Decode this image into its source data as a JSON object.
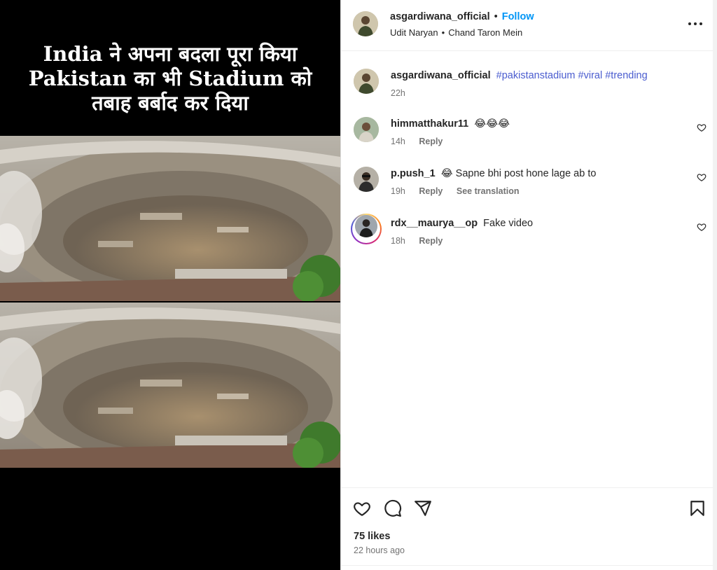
{
  "media": {
    "caption_lines": [
      "India ने अपना बदला पूरा किया",
      "Pakistan का भी Stadium को",
      "तबाह बर्बाद कर दिया"
    ]
  },
  "header": {
    "username": "asgardiwana_official",
    "dot": "•",
    "follow_label": "Follow",
    "audio_artist": "Udit Naryan",
    "audio_sep": "•",
    "audio_track": "Chand Taron Mein"
  },
  "caption_comment": {
    "username": "asgardiwana_official",
    "hashtags": "#pakistanstadium #viral #trending",
    "time": "22h"
  },
  "comments": [
    {
      "username": "himmatthakur11",
      "text": "😂😂😂",
      "time": "14h",
      "reply": "Reply",
      "translation": ""
    },
    {
      "username": "p.push_1",
      "text": "😂 Sapne bhi post hone lage ab to",
      "time": "19h",
      "reply": "Reply",
      "translation": "See translation"
    },
    {
      "username": "rdx__maurya__op",
      "text": "Fake video",
      "time": "18h",
      "reply": "Reply",
      "translation": ""
    }
  ],
  "actions": {
    "likes": "75 likes",
    "timestamp": "22 hours ago"
  },
  "colors": {
    "follow": "#0095f6",
    "hashtag": "#4a5ccf",
    "text": "#262626",
    "muted": "#737373"
  },
  "icons": [
    "more-icon",
    "heart-icon",
    "comment-icon",
    "share-icon",
    "bookmark-icon"
  ]
}
